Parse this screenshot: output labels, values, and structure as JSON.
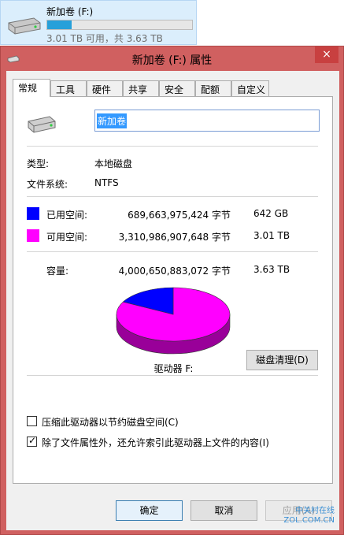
{
  "drive_tile": {
    "name": "新加卷 (F:)",
    "free_text": "3.01 TB 可用，共 3.63 TB",
    "used_fraction": 0.17,
    "icon": "hard-drive-icon"
  },
  "window": {
    "title": "新加卷 (F:) 属性",
    "close_label": "×"
  },
  "tabs": [
    "常规",
    "工具",
    "硬件",
    "共享",
    "安全",
    "配额",
    "自定义"
  ],
  "general": {
    "volume_name": "新加卷",
    "type_label": "类型:",
    "type_value": "本地磁盘",
    "fs_label": "文件系统:",
    "fs_value": "NTFS",
    "used": {
      "label": "已用空间:",
      "bytes": "689,663,975,424 字节",
      "size": "642 GB",
      "color": "#0000ff"
    },
    "free": {
      "label": "可用空间:",
      "bytes": "3,310,986,907,648 字节",
      "size": "3.01 TB",
      "color": "#ff00ff"
    },
    "capacity": {
      "label": "容量:",
      "bytes": "4,000,650,883,072 字节",
      "size": "3.63 TB"
    },
    "drive_label": "驱动器 F:",
    "cleanup_button": "磁盘清理(D)",
    "compress_label": "压缩此驱动器以节约磁盘空间(C)",
    "compress_checked": false,
    "index_label": "除了文件属性外，还允许索引此驱动器上文件的内容(I)",
    "index_checked": true
  },
  "buttons": {
    "ok": "确定",
    "cancel": "取消",
    "apply": "应用(A)"
  },
  "watermark": {
    "line1": "中关村在线",
    "line2": "ZOL.COM.CN"
  }
}
